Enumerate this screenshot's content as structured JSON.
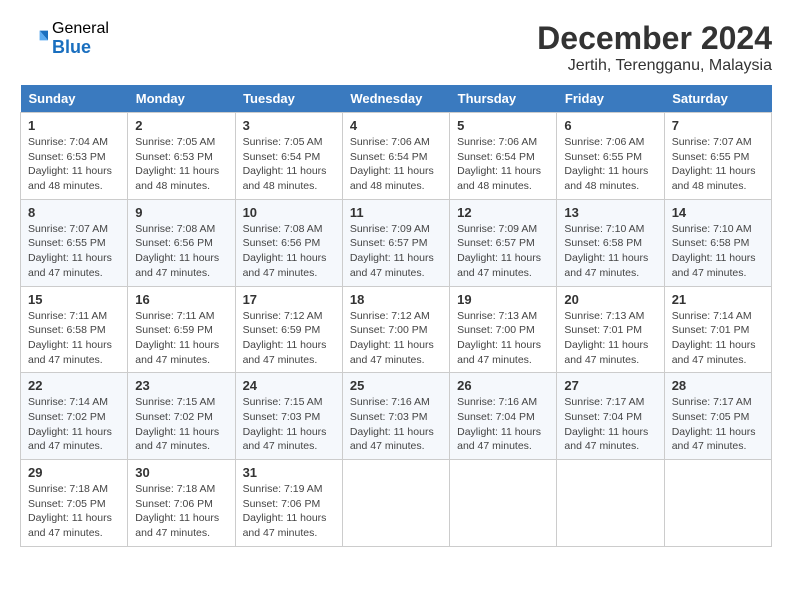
{
  "header": {
    "logo_general": "General",
    "logo_blue": "Blue",
    "month_title": "December 2024",
    "location": "Jertih, Terengganu, Malaysia"
  },
  "weekdays": [
    "Sunday",
    "Monday",
    "Tuesday",
    "Wednesday",
    "Thursday",
    "Friday",
    "Saturday"
  ],
  "weeks": [
    [
      {
        "day": "1",
        "sunrise": "7:04 AM",
        "sunset": "6:53 PM",
        "daylight": "11 hours and 48 minutes."
      },
      {
        "day": "2",
        "sunrise": "7:05 AM",
        "sunset": "6:53 PM",
        "daylight": "11 hours and 48 minutes."
      },
      {
        "day": "3",
        "sunrise": "7:05 AM",
        "sunset": "6:54 PM",
        "daylight": "11 hours and 48 minutes."
      },
      {
        "day": "4",
        "sunrise": "7:06 AM",
        "sunset": "6:54 PM",
        "daylight": "11 hours and 48 minutes."
      },
      {
        "day": "5",
        "sunrise": "7:06 AM",
        "sunset": "6:54 PM",
        "daylight": "11 hours and 48 minutes."
      },
      {
        "day": "6",
        "sunrise": "7:06 AM",
        "sunset": "6:55 PM",
        "daylight": "11 hours and 48 minutes."
      },
      {
        "day": "7",
        "sunrise": "7:07 AM",
        "sunset": "6:55 PM",
        "daylight": "11 hours and 48 minutes."
      }
    ],
    [
      {
        "day": "8",
        "sunrise": "7:07 AM",
        "sunset": "6:55 PM",
        "daylight": "11 hours and 47 minutes."
      },
      {
        "day": "9",
        "sunrise": "7:08 AM",
        "sunset": "6:56 PM",
        "daylight": "11 hours and 47 minutes."
      },
      {
        "day": "10",
        "sunrise": "7:08 AM",
        "sunset": "6:56 PM",
        "daylight": "11 hours and 47 minutes."
      },
      {
        "day": "11",
        "sunrise": "7:09 AM",
        "sunset": "6:57 PM",
        "daylight": "11 hours and 47 minutes."
      },
      {
        "day": "12",
        "sunrise": "7:09 AM",
        "sunset": "6:57 PM",
        "daylight": "11 hours and 47 minutes."
      },
      {
        "day": "13",
        "sunrise": "7:10 AM",
        "sunset": "6:58 PM",
        "daylight": "11 hours and 47 minutes."
      },
      {
        "day": "14",
        "sunrise": "7:10 AM",
        "sunset": "6:58 PM",
        "daylight": "11 hours and 47 minutes."
      }
    ],
    [
      {
        "day": "15",
        "sunrise": "7:11 AM",
        "sunset": "6:58 PM",
        "daylight": "11 hours and 47 minutes."
      },
      {
        "day": "16",
        "sunrise": "7:11 AM",
        "sunset": "6:59 PM",
        "daylight": "11 hours and 47 minutes."
      },
      {
        "day": "17",
        "sunrise": "7:12 AM",
        "sunset": "6:59 PM",
        "daylight": "11 hours and 47 minutes."
      },
      {
        "day": "18",
        "sunrise": "7:12 AM",
        "sunset": "7:00 PM",
        "daylight": "11 hours and 47 minutes."
      },
      {
        "day": "19",
        "sunrise": "7:13 AM",
        "sunset": "7:00 PM",
        "daylight": "11 hours and 47 minutes."
      },
      {
        "day": "20",
        "sunrise": "7:13 AM",
        "sunset": "7:01 PM",
        "daylight": "11 hours and 47 minutes."
      },
      {
        "day": "21",
        "sunrise": "7:14 AM",
        "sunset": "7:01 PM",
        "daylight": "11 hours and 47 minutes."
      }
    ],
    [
      {
        "day": "22",
        "sunrise": "7:14 AM",
        "sunset": "7:02 PM",
        "daylight": "11 hours and 47 minutes."
      },
      {
        "day": "23",
        "sunrise": "7:15 AM",
        "sunset": "7:02 PM",
        "daylight": "11 hours and 47 minutes."
      },
      {
        "day": "24",
        "sunrise": "7:15 AM",
        "sunset": "7:03 PM",
        "daylight": "11 hours and 47 minutes."
      },
      {
        "day": "25",
        "sunrise": "7:16 AM",
        "sunset": "7:03 PM",
        "daylight": "11 hours and 47 minutes."
      },
      {
        "day": "26",
        "sunrise": "7:16 AM",
        "sunset": "7:04 PM",
        "daylight": "11 hours and 47 minutes."
      },
      {
        "day": "27",
        "sunrise": "7:17 AM",
        "sunset": "7:04 PM",
        "daylight": "11 hours and 47 minutes."
      },
      {
        "day": "28",
        "sunrise": "7:17 AM",
        "sunset": "7:05 PM",
        "daylight": "11 hours and 47 minutes."
      }
    ],
    [
      {
        "day": "29",
        "sunrise": "7:18 AM",
        "sunset": "7:05 PM",
        "daylight": "11 hours and 47 minutes."
      },
      {
        "day": "30",
        "sunrise": "7:18 AM",
        "sunset": "7:06 PM",
        "daylight": "11 hours and 47 minutes."
      },
      {
        "day": "31",
        "sunrise": "7:19 AM",
        "sunset": "7:06 PM",
        "daylight": "11 hours and 47 minutes."
      },
      null,
      null,
      null,
      null
    ]
  ]
}
